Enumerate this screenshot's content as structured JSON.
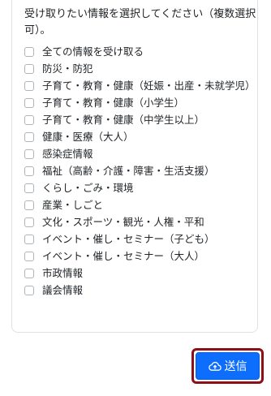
{
  "form": {
    "intro": "受け取りたい情報を選択してください（複数選択可）。",
    "options": [
      {
        "label": "全ての情報を受け取る",
        "checked": false
      },
      {
        "label": "防災・防犯",
        "checked": false
      },
      {
        "label": "子育て・教育・健康（妊娠・出産・未就学児）",
        "checked": false
      },
      {
        "label": "子育て・教育・健康（小学生）",
        "checked": false
      },
      {
        "label": "子育て・教育・健康（中学生以上）",
        "checked": false
      },
      {
        "label": "健康・医療（大人）",
        "checked": false
      },
      {
        "label": "感染症情報",
        "checked": false
      },
      {
        "label": "福祉（高齢・介護・障害・生活支援）",
        "checked": false
      },
      {
        "label": "くらし・ごみ・環境",
        "checked": false
      },
      {
        "label": "産業・しごと",
        "checked": false
      },
      {
        "label": "文化・スポーツ・観光・人権・平和",
        "checked": false
      },
      {
        "label": "イベント・催し・セミナー（子ども）",
        "checked": false
      },
      {
        "label": "イベント・催し・セミナー（大人）",
        "checked": false
      },
      {
        "label": "市政情報",
        "checked": false
      },
      {
        "label": "議会情報",
        "checked": false
      }
    ],
    "submit": {
      "label": "送信",
      "icon": "cloud-upload-icon"
    }
  },
  "colors": {
    "primary": "#0d6efd",
    "highlight_border": "#8b1018",
    "card_border": "#dee2e6"
  }
}
